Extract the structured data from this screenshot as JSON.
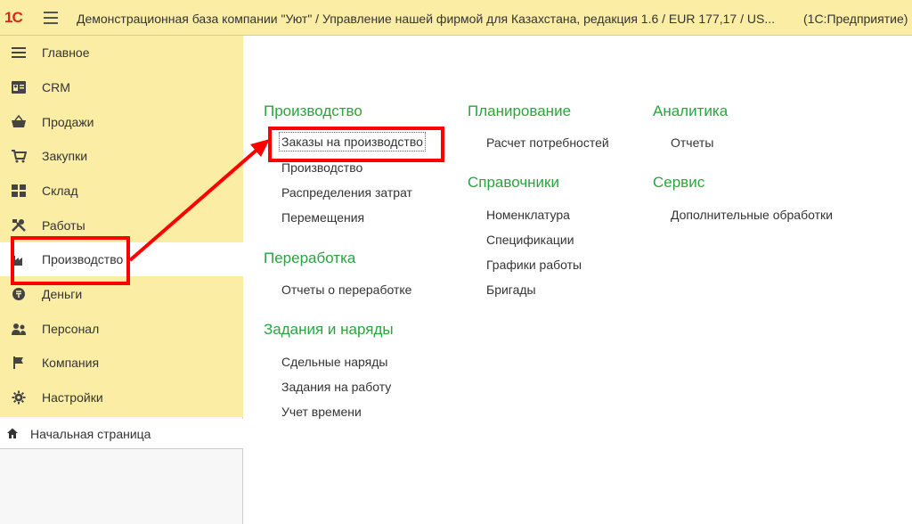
{
  "titlebar": {
    "logo": "1С",
    "title": "Демонстрационная база компании \"Уют\" / Управление нашей фирмой для Казахстана, редакция 1.6 / EUR 177,17 / US...",
    "app": "(1С:Предприятие)"
  },
  "sidebar": {
    "items": [
      {
        "label": "Главное",
        "icon": "list-icon"
      },
      {
        "label": "CRM",
        "icon": "crm-icon"
      },
      {
        "label": "Продажи",
        "icon": "basket-icon"
      },
      {
        "label": "Закупки",
        "icon": "cart-icon"
      },
      {
        "label": "Склад",
        "icon": "warehouse-icon"
      },
      {
        "label": "Работы",
        "icon": "tools-icon"
      },
      {
        "label": "Производство",
        "icon": "factory-icon",
        "active": true
      },
      {
        "label": "Деньги",
        "icon": "money-icon"
      },
      {
        "label": "Персонал",
        "icon": "people-icon"
      },
      {
        "label": "Компания",
        "icon": "flag-icon"
      },
      {
        "label": "Настройки",
        "icon": "gear-icon"
      }
    ],
    "home": {
      "label": "Начальная страница",
      "icon": "home-icon"
    }
  },
  "content": {
    "col1": {
      "groups": [
        {
          "title": "Производство",
          "links": [
            "Заказы на производство",
            "Производство",
            "Распределения затрат",
            "Перемещения"
          ]
        },
        {
          "title": "Переработка",
          "links": [
            "Отчеты о переработке"
          ]
        },
        {
          "title": "Задания и наряды",
          "links": [
            "Сдельные наряды",
            "Задания на работу",
            "Учет времени"
          ]
        }
      ]
    },
    "col2": {
      "groups": [
        {
          "title": "Планирование",
          "links": [
            "Расчет потребностей"
          ]
        },
        {
          "title": "Справочники",
          "links": [
            "Номенклатура",
            "Спецификации",
            "Графики работы",
            "Бригады"
          ]
        }
      ]
    },
    "col3": {
      "groups": [
        {
          "title": "Аналитика",
          "links": [
            "Отчеты"
          ]
        },
        {
          "title": "Сервис",
          "links": [
            "Дополнительные обработки"
          ]
        }
      ]
    }
  },
  "colors": {
    "header_bg": "#fbeda4",
    "group_title": "#2aa53d",
    "annotation": "#ff0000"
  }
}
